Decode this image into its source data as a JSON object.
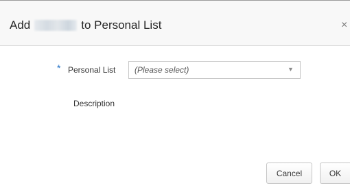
{
  "dialog": {
    "title_prefix": "Add",
    "title_name": "Lee Von",
    "title_suffix": "to Personal List",
    "close_glyph": "×"
  },
  "form": {
    "required_marker": "*",
    "personal_list_label": "Personal List",
    "personal_list_value": "(Please select)",
    "dropdown_arrow": "▼",
    "description_label": "Description"
  },
  "buttons": {
    "cancel_label": "Cancel",
    "ok_label": "OK"
  },
  "colors": {
    "required_marker": "#1f6fc5",
    "header_background": "#f8f8f8",
    "text": "#333333"
  }
}
